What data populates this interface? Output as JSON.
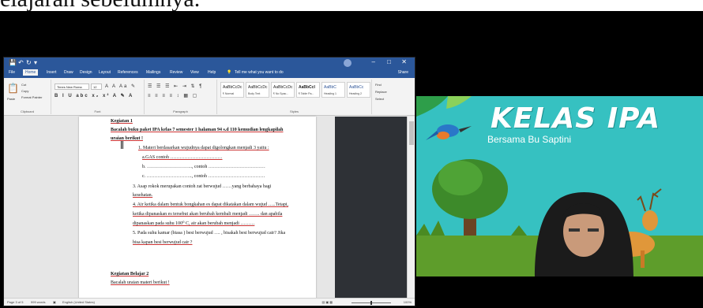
{
  "caption": {
    "text": "elajaran sebelumnya."
  },
  "word": {
    "titlebar": {
      "qat": [
        "💾",
        "↶",
        "↻",
        "▾"
      ],
      "search_label": "Tell me what you want to do",
      "controls": [
        "–",
        "□",
        "✕"
      ]
    },
    "menu_tabs": [
      "File",
      "Home",
      "Insert",
      "Draw",
      "Design",
      "Layout",
      "References",
      "Mailings",
      "Review",
      "View",
      "Help"
    ],
    "share_label": "Share",
    "ribbon": {
      "clipboard": {
        "paste": "Paste",
        "cut": "Cut",
        "copy": "Copy",
        "format_painter": "Format Painter",
        "label": "Clipboard"
      },
      "font": {
        "name": "Times New Roma",
        "size": "12",
        "label": "Font"
      },
      "paragraph": {
        "label": "Paragraph"
      },
      "styles": {
        "label": "Styles",
        "tiles": [
          {
            "preview": "AaBbCcDc",
            "name": "¶ Normal"
          },
          {
            "preview": "AaBbCcDc",
            "name": "Body Text"
          },
          {
            "preview": "AaBbCcDc",
            "name": "¶ No Spac..."
          },
          {
            "preview": "AaBbCcI",
            "name": "¶ Table Pa..."
          },
          {
            "preview": "AaBbC",
            "name": "Heading 1"
          },
          {
            "preview": "AaBbCc",
            "name": "Heading 2"
          }
        ]
      },
      "editing": {
        "find": "Find",
        "replace": "Replace",
        "select": "Select"
      }
    },
    "document": {
      "heading1": "Kegiatan 1",
      "instr1": "Bacalah buku paket IPA  kelas 7 semester 1 halaman 94 s.d 110 kemudian lengkapilah",
      "instr2": "uraian berikut !",
      "q1": "1.   Materi berdasarkan wujudnya dapat digolongkan menjadi 3 yaitu :",
      "q1a": "a.GAS                        contoh ……………………………",
      "q1b": "b. ………………………..,  contoh ………………………………",
      "q1c": "c. ………………………..,  contoh ………………………………",
      "q3": "3. Asap rokok merupakan contoh zat berwujud ……yang berbahaya bagi",
      "q3b": "kesehatan.",
      "q4": "4. Air ketika dalam bentuk bongkahan es  dapat dikatakan dalam wujud …..Tetapi,",
      "q4b": "ketika dipanaskan es tersebut akan berubah kembali menjadi ……. dan apabila",
      "q4c": "dipanaskan pada  suhu  100⁰ C, air akan berubah menjadi  ………",
      "q5": "5. Pada suhu kamar (biasa ) besi berwujud …. , bisakah besi berwujud cair? Jika",
      "q5b": "bisa kapan besi berwujud cair ?",
      "heading2": "Kegiatan Belajar 2",
      "instr3": "Bacalah uraian materi berikut !"
    },
    "status": {
      "page": "Page 3 of 5",
      "words": "999 words",
      "language": "English (United States)",
      "zoom": "100%"
    }
  },
  "camera": {
    "title": "KELAS IPA",
    "subtitle": "Bersama Bu Saptini"
  }
}
